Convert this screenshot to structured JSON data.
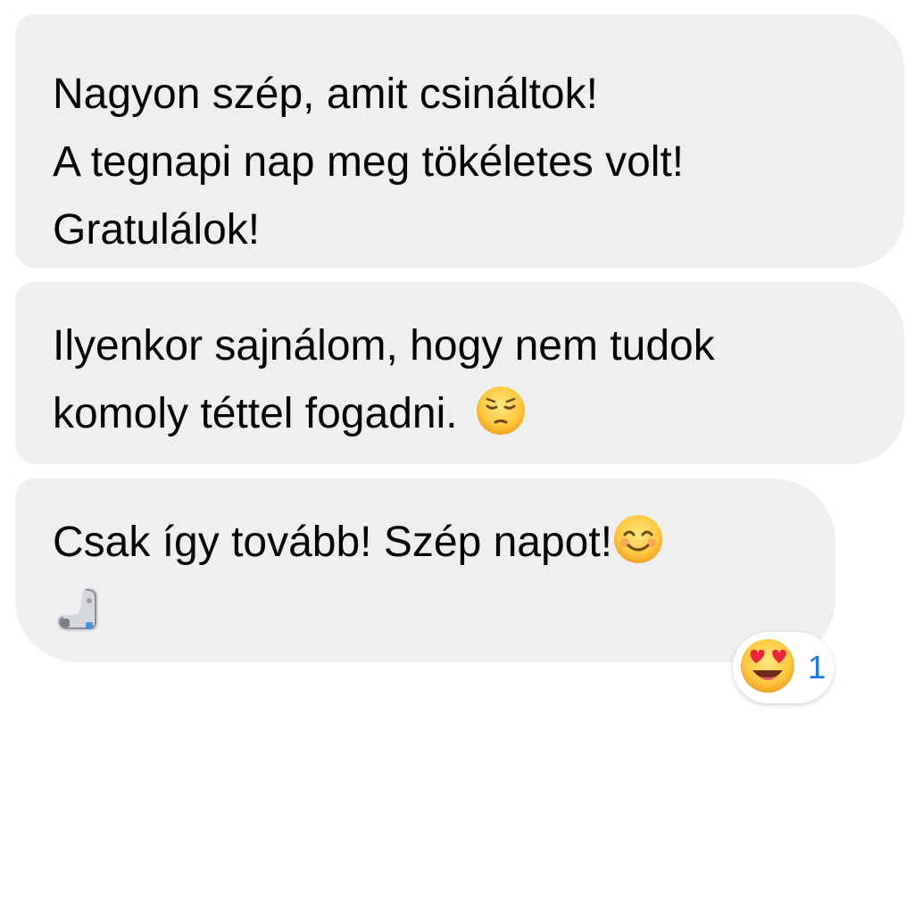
{
  "messages": [
    {
      "lines": [
        "Nagyon szép, amit csináltok!",
        "A tegnapi nap meg tökéletes volt!",
        "Gratulálok!"
      ]
    },
    {
      "lines": [
        "Ilyenkor sajnálom, hogy nem tudok",
        "komoly téttel fogadni."
      ],
      "trailing_emoji": "pensive-face-icon"
    },
    {
      "lines": [
        "Csak így tovább! Szép napot!"
      ],
      "trailing_emoji": "smiling-face-icon",
      "second_line_emoji": "flexed-biceps-icon",
      "reaction": {
        "emoji": "heart-eyes-icon",
        "count": "1"
      }
    }
  ],
  "colors": {
    "bubble_background": "#efefef",
    "reaction_count": "#1877f2",
    "text": "#050505"
  }
}
